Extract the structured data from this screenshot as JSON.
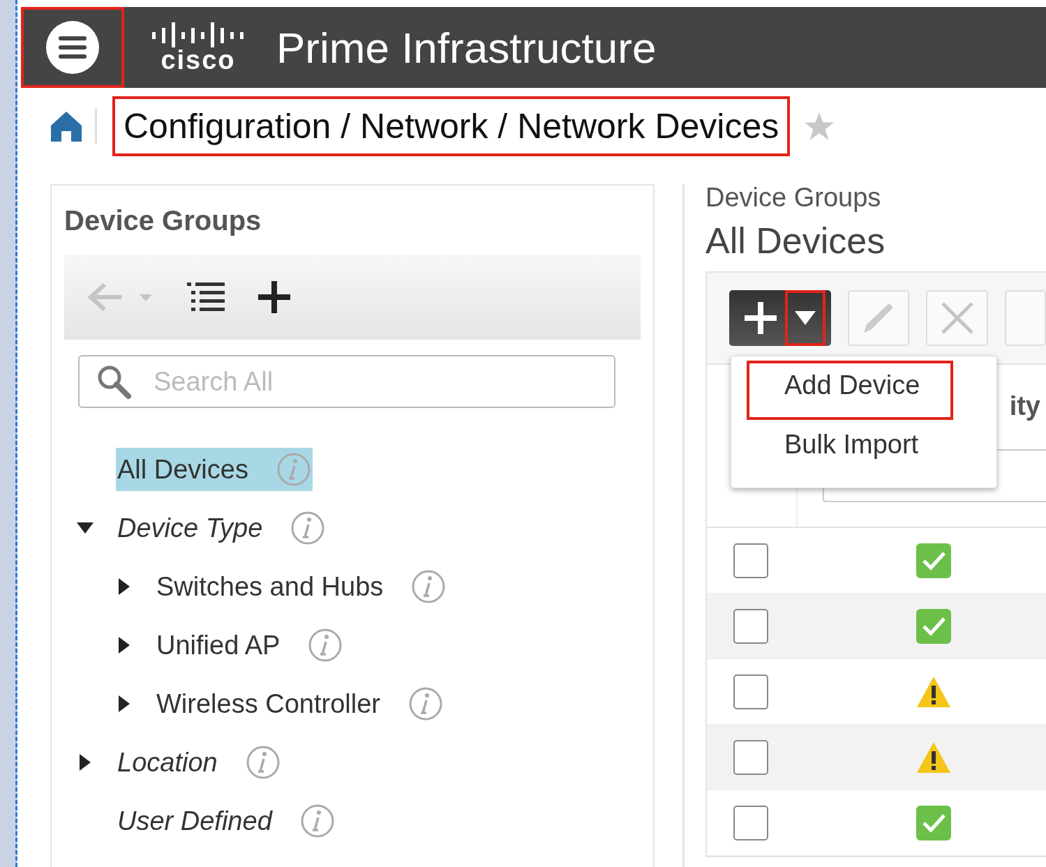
{
  "header": {
    "menu_highlighted": true,
    "logo": "cisco",
    "title": "Prime Infrastructure"
  },
  "breadcrumb": {
    "text": "Configuration / Network / Network Devices",
    "highlighted": true,
    "favorite": false
  },
  "left_panel": {
    "title": "Device Groups",
    "search": {
      "placeholder": "Search All"
    },
    "tree": [
      {
        "label": "All Devices",
        "italic": false,
        "selected": true
      },
      {
        "label": "Device Type",
        "italic": true,
        "selected": false,
        "expanded": true,
        "children": [
          {
            "label": "Switches and Hubs",
            "italic": false,
            "selected": false,
            "expanded": false
          },
          {
            "label": "Unified AP",
            "italic": false,
            "selected": false,
            "expanded": false
          },
          {
            "label": "Wireless Controller",
            "italic": false,
            "selected": false,
            "expanded": false
          }
        ]
      },
      {
        "label": "Location",
        "italic": true,
        "selected": false,
        "expanded": false
      },
      {
        "label": "User Defined",
        "italic": true,
        "selected": false
      }
    ]
  },
  "right_panel": {
    "subtitle": "Device Groups",
    "title": "All Devices",
    "add_caret_highlighted": true,
    "add_menu": [
      {
        "label": "Add Device",
        "highlighted": true
      },
      {
        "label": "Bulk Import",
        "highlighted": false
      }
    ],
    "column_2_header": "ity",
    "rows": [
      {
        "checked": false,
        "kind": "ok"
      },
      {
        "checked": false,
        "kind": "ok"
      },
      {
        "checked": false,
        "kind": "warning"
      },
      {
        "checked": false,
        "kind": "warning"
      },
      {
        "checked": false,
        "kind": "ok"
      }
    ]
  }
}
